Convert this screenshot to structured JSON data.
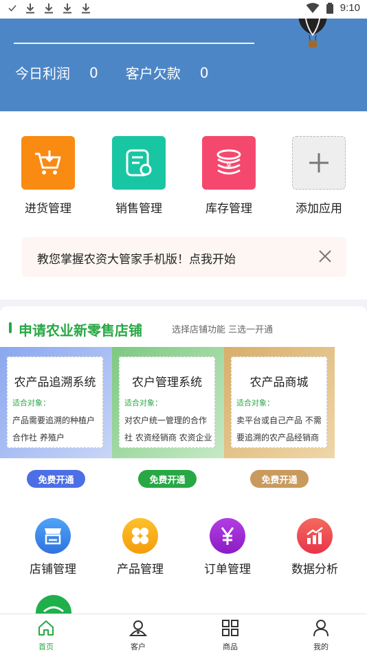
{
  "status_bar": {
    "time": "9:10",
    "left_icons": [
      "check-icon",
      "download-icon",
      "download-icon",
      "download-icon",
      "download-icon"
    ],
    "right_icons": [
      "wifi-icon",
      "battery-icon"
    ]
  },
  "header": {
    "profit_label": "今日利润",
    "profit_value": "0",
    "debt_label": "客户欠款",
    "debt_value": "0"
  },
  "apps": [
    {
      "label": "进货管理",
      "icon": "cart-download-icon",
      "color": "#f98a12"
    },
    {
      "label": "销售管理",
      "icon": "sales-doc-icon",
      "color": "#19c6a3"
    },
    {
      "label": "库存管理",
      "icon": "coins-icon",
      "color": "#f5486e"
    },
    {
      "label": "添加应用",
      "icon": "plus-icon",
      "color": "#eeeeee"
    }
  ],
  "tip": {
    "text": "教您掌握农资大管家手机版！点我开始",
    "close_icon": "close-icon"
  },
  "store": {
    "title": "申请农业新零售店铺",
    "subtitle": "选择店铺功能 三选一开通",
    "plans": [
      {
        "name": "农产品追溯系统",
        "target_label": "适合对象：",
        "desc_line1": "产品需要追溯的种植户",
        "desc_line2": "合作社  养殖户",
        "button": "免费开通",
        "button_color": "#4c6fe6",
        "bg_color": "#a9bdf2"
      },
      {
        "name": "农户管理系统",
        "target_label": "适合对象：",
        "desc_line1": "对农户统一管理的合作",
        "desc_line2": "社 农资经销商 农资企业",
        "button": "免费开通",
        "button_color": "#27a844",
        "bg_color": "#9fd8a2"
      },
      {
        "name": "农产品商城",
        "target_label": "适合对象：",
        "desc_line1": "卖平台或自己产品 不需",
        "desc_line2": "要追溯的农产品经销商",
        "button": "免费开通",
        "button_color": "#c99a5e",
        "bg_color": "#e7c58e"
      }
    ],
    "tools": [
      {
        "label": "店铺管理",
        "icon": "store-icon",
        "color": "#3d8ff0"
      },
      {
        "label": "产品管理",
        "icon": "grid-flower-icon",
        "color": "#f9b413"
      },
      {
        "label": "订单管理",
        "icon": "yen-icon",
        "color": "#a22ad6"
      },
      {
        "label": "数据分析",
        "icon": "chart-icon",
        "color": "#ef4a50"
      }
    ]
  },
  "bottom_nav": [
    {
      "label": "首页",
      "icon": "home-icon",
      "active": true
    },
    {
      "label": "客户",
      "icon": "customer-icon",
      "active": false
    },
    {
      "label": "商品",
      "icon": "goods-icon",
      "active": false
    },
    {
      "label": "我的",
      "icon": "profile-icon",
      "active": false
    }
  ]
}
